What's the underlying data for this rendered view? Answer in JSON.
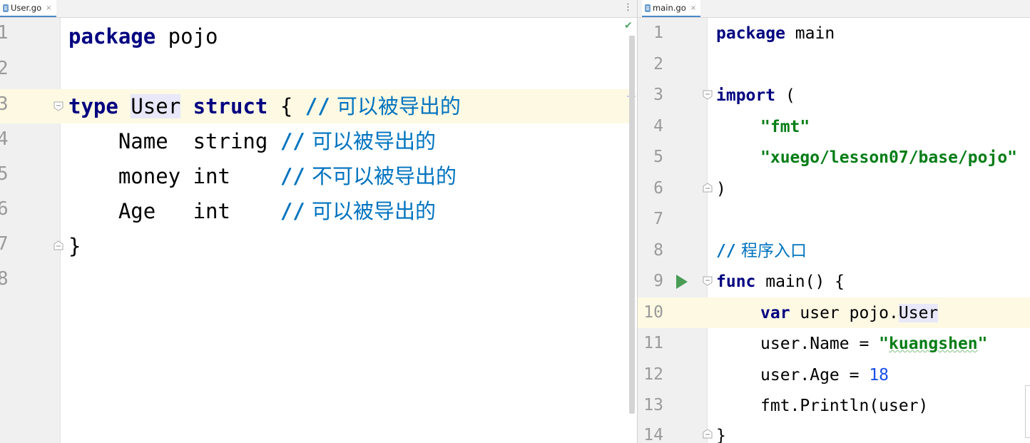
{
  "left_editor": {
    "tab": {
      "label": "User.go",
      "close": "×"
    },
    "tab_menu": "⋮",
    "line_numbers": [
      "1",
      "2",
      "3",
      "4",
      "5",
      "6",
      "7",
      "8"
    ],
    "code": {
      "l1_kw": "package",
      "l1_name": " pojo",
      "l3_kw": "type",
      "l3_type": "User",
      "l3_kw2": "struct",
      "l3_brace": " { ",
      "l3_slashes": "//",
      "l3_comment": " 可以被导出的",
      "l4_field": "    Name  string ",
      "l4_slashes": "//",
      "l4_comment": " 可以被导出的",
      "l5_field": "    money int    ",
      "l5_slashes": "//",
      "l5_comment": " 不可以被导出的",
      "l6_field": "    Age   int    ",
      "l6_slashes": "//",
      "l6_comment": " 可以被导出的",
      "l7_brace": "}"
    },
    "status_icon": "✔"
  },
  "right_editor": {
    "tab": {
      "label": "main.go",
      "close": "×"
    },
    "line_numbers": [
      "1",
      "2",
      "3",
      "4",
      "5",
      "6",
      "7",
      "8",
      "9",
      "10",
      "11",
      "12",
      "13",
      "14"
    ],
    "code": {
      "l1_kw": "package",
      "l1_name": " main",
      "l3_kw": "import",
      "l3_paren": " (",
      "l4_str": "\"fmt\"",
      "l5_str": "\"xuego/lesson07/base/pojo\"",
      "l6_paren": ")",
      "l8_slashes": "//",
      "l8_comment": " 程序入口",
      "l9_kw": "func",
      "l9_rest": " main() {",
      "l10_kw": "var",
      "l10_rest": " user pojo.",
      "l10_type": "User",
      "l11_a": "user.Name = ",
      "l11_str_q1": "\"",
      "l11_str": "kuangshen",
      "l11_str_q2": "\"",
      "l12_a": "user.Age = ",
      "l12_num": "18",
      "l13": "fmt.Println(user)",
      "l14": "}"
    }
  }
}
